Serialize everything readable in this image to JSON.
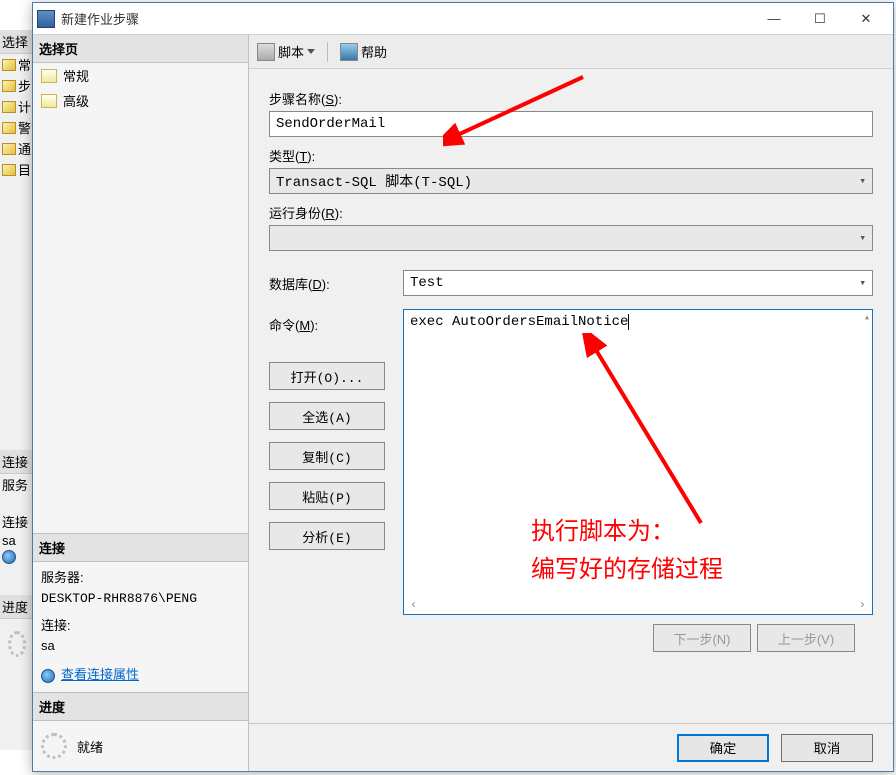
{
  "backdrop": {
    "header_sel": "选择",
    "items_top": [
      "常",
      "步",
      "计",
      "警",
      "通",
      "目"
    ],
    "header_conn": "连接",
    "server_lbl": "服务",
    "conn_lbl": "连接",
    "sa": "sa",
    "header_prog": "进度"
  },
  "title": "新建作业步骤",
  "win": {
    "min": "—",
    "max": "☐",
    "close": "✕"
  },
  "left": {
    "header_sel": "选择页",
    "nav": [
      "常规",
      "高级"
    ],
    "header_conn": "连接",
    "server_label": "服务器:",
    "server_value": "DESKTOP-RHR8876\\PENG",
    "conn_label": "连接:",
    "conn_value": "sa",
    "view_props": "查看连接属性",
    "header_prog": "进度",
    "ready": "就绪"
  },
  "toolbar": {
    "script": "脚本",
    "help": "帮助"
  },
  "form": {
    "step_label_pre": "步骤名称(",
    "step_label_accel": "S",
    "step_label_post": "):",
    "step_value": "SendOrderMail",
    "type_label_pre": "类型(",
    "type_label_accel": "T",
    "type_label_post": "):",
    "type_value": "Transact-SQL 脚本(T-SQL)",
    "runas_label_pre": "运行身份(",
    "runas_label_accel": "R",
    "runas_label_post": "):",
    "runas_value": "",
    "db_label_pre": "数据库(",
    "db_label_accel": "D",
    "db_label_post": "):",
    "db_value": "Test",
    "cmd_label_pre": "命令(",
    "cmd_label_accel": "M",
    "cmd_label_post": "):",
    "cmd_value": "exec AutoOrdersEmailNotice",
    "btn_open": "打开(O)...",
    "btn_selectall": "全选(A)",
    "btn_copy": "复制(C)",
    "btn_paste": "粘贴(P)",
    "btn_analyze": "分析(E)",
    "btn_next": "下一步(N)",
    "btn_prev": "上一步(V)"
  },
  "footer": {
    "ok": "确定",
    "cancel": "取消"
  },
  "annotation": {
    "line1": "执行脚本为：",
    "line2": "编写好的存储过程"
  }
}
